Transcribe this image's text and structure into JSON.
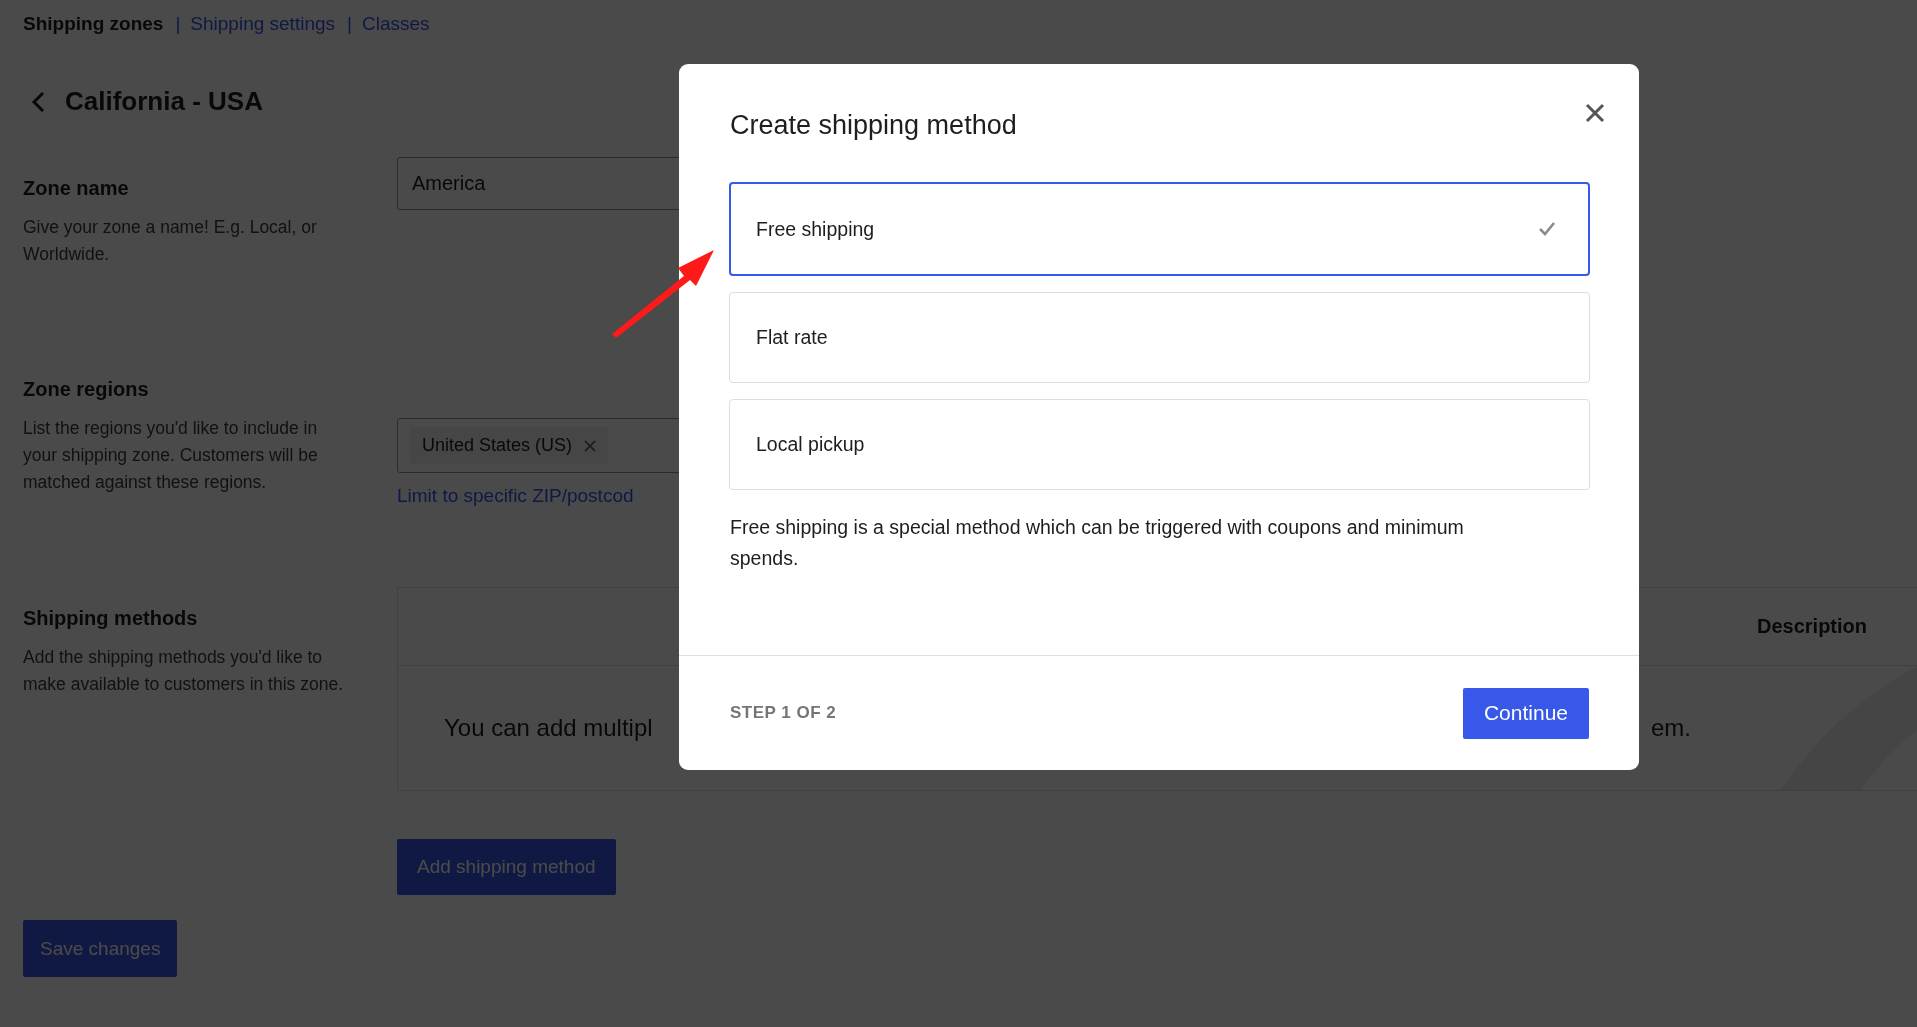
{
  "nav": {
    "items": [
      {
        "label": "Shipping zones",
        "selected": true
      },
      {
        "label": "Shipping settings",
        "selected": false
      },
      {
        "label": "Classes",
        "selected": false
      }
    ],
    "separators": [
      "|",
      "|"
    ]
  },
  "page": {
    "title": "California - USA"
  },
  "zone_name": {
    "heading": "Zone name",
    "description": "Give your zone a name! E.g. Local, or Worldwide.",
    "value": "America"
  },
  "zone_regions": {
    "heading": "Zone regions",
    "description": "List the regions you'd like to include in your shipping zone. Customers will be matched against these regions.",
    "chips": [
      {
        "label": "United States (US)"
      }
    ],
    "link": "Limit to specific ZIP/postcod"
  },
  "shipping_methods": {
    "heading": "Shipping methods",
    "description": "Add the shipping methods you'd like to make available to customers in this zone.",
    "table": {
      "columns": [
        "Description"
      ],
      "empty_text_parts": [
        "You can add multipl",
        "em."
      ]
    },
    "add_button": "Add shipping method"
  },
  "save_button": "Save changes",
  "modal": {
    "title": "Create shipping method",
    "options": [
      {
        "label": "Free shipping",
        "selected": true
      },
      {
        "label": "Flat rate",
        "selected": false
      },
      {
        "label": "Local pickup",
        "selected": false
      }
    ],
    "description": "Free shipping is a special method which can be triggered with coupons and minimum spends.",
    "step": "STEP 1 OF 2",
    "continue_button": "Continue"
  }
}
